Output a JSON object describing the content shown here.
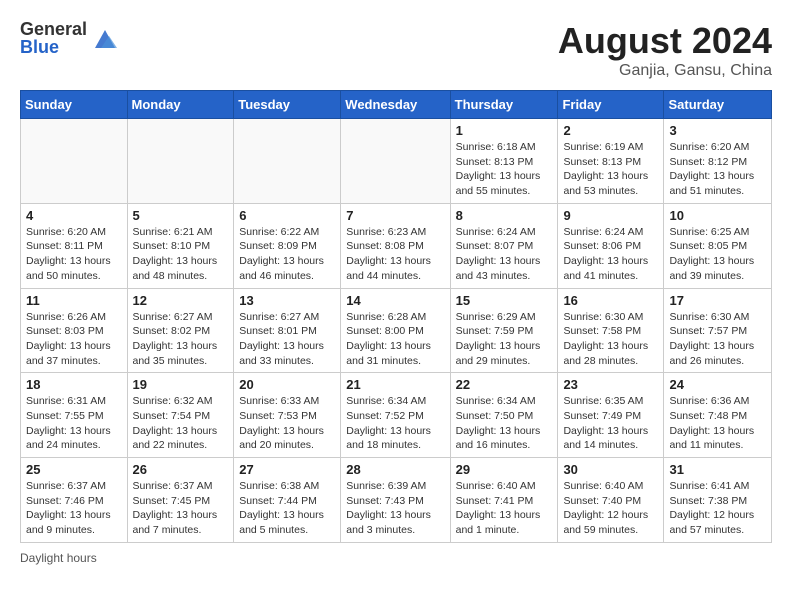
{
  "header": {
    "logo_general": "General",
    "logo_blue": "Blue",
    "month_title": "August 2024",
    "location": "Ganjia, Gansu, China"
  },
  "days_of_week": [
    "Sunday",
    "Monday",
    "Tuesday",
    "Wednesday",
    "Thursday",
    "Friday",
    "Saturday"
  ],
  "weeks": [
    [
      {
        "day": "",
        "info": ""
      },
      {
        "day": "",
        "info": ""
      },
      {
        "day": "",
        "info": ""
      },
      {
        "day": "",
        "info": ""
      },
      {
        "day": "1",
        "info": "Sunrise: 6:18 AM\nSunset: 8:13 PM\nDaylight: 13 hours\nand 55 minutes."
      },
      {
        "day": "2",
        "info": "Sunrise: 6:19 AM\nSunset: 8:13 PM\nDaylight: 13 hours\nand 53 minutes."
      },
      {
        "day": "3",
        "info": "Sunrise: 6:20 AM\nSunset: 8:12 PM\nDaylight: 13 hours\nand 51 minutes."
      }
    ],
    [
      {
        "day": "4",
        "info": "Sunrise: 6:20 AM\nSunset: 8:11 PM\nDaylight: 13 hours\nand 50 minutes."
      },
      {
        "day": "5",
        "info": "Sunrise: 6:21 AM\nSunset: 8:10 PM\nDaylight: 13 hours\nand 48 minutes."
      },
      {
        "day": "6",
        "info": "Sunrise: 6:22 AM\nSunset: 8:09 PM\nDaylight: 13 hours\nand 46 minutes."
      },
      {
        "day": "7",
        "info": "Sunrise: 6:23 AM\nSunset: 8:08 PM\nDaylight: 13 hours\nand 44 minutes."
      },
      {
        "day": "8",
        "info": "Sunrise: 6:24 AM\nSunset: 8:07 PM\nDaylight: 13 hours\nand 43 minutes."
      },
      {
        "day": "9",
        "info": "Sunrise: 6:24 AM\nSunset: 8:06 PM\nDaylight: 13 hours\nand 41 minutes."
      },
      {
        "day": "10",
        "info": "Sunrise: 6:25 AM\nSunset: 8:05 PM\nDaylight: 13 hours\nand 39 minutes."
      }
    ],
    [
      {
        "day": "11",
        "info": "Sunrise: 6:26 AM\nSunset: 8:03 PM\nDaylight: 13 hours\nand 37 minutes."
      },
      {
        "day": "12",
        "info": "Sunrise: 6:27 AM\nSunset: 8:02 PM\nDaylight: 13 hours\nand 35 minutes."
      },
      {
        "day": "13",
        "info": "Sunrise: 6:27 AM\nSunset: 8:01 PM\nDaylight: 13 hours\nand 33 minutes."
      },
      {
        "day": "14",
        "info": "Sunrise: 6:28 AM\nSunset: 8:00 PM\nDaylight: 13 hours\nand 31 minutes."
      },
      {
        "day": "15",
        "info": "Sunrise: 6:29 AM\nSunset: 7:59 PM\nDaylight: 13 hours\nand 29 minutes."
      },
      {
        "day": "16",
        "info": "Sunrise: 6:30 AM\nSunset: 7:58 PM\nDaylight: 13 hours\nand 28 minutes."
      },
      {
        "day": "17",
        "info": "Sunrise: 6:30 AM\nSunset: 7:57 PM\nDaylight: 13 hours\nand 26 minutes."
      }
    ],
    [
      {
        "day": "18",
        "info": "Sunrise: 6:31 AM\nSunset: 7:55 PM\nDaylight: 13 hours\nand 24 minutes."
      },
      {
        "day": "19",
        "info": "Sunrise: 6:32 AM\nSunset: 7:54 PM\nDaylight: 13 hours\nand 22 minutes."
      },
      {
        "day": "20",
        "info": "Sunrise: 6:33 AM\nSunset: 7:53 PM\nDaylight: 13 hours\nand 20 minutes."
      },
      {
        "day": "21",
        "info": "Sunrise: 6:34 AM\nSunset: 7:52 PM\nDaylight: 13 hours\nand 18 minutes."
      },
      {
        "day": "22",
        "info": "Sunrise: 6:34 AM\nSunset: 7:50 PM\nDaylight: 13 hours\nand 16 minutes."
      },
      {
        "day": "23",
        "info": "Sunrise: 6:35 AM\nSunset: 7:49 PM\nDaylight: 13 hours\nand 14 minutes."
      },
      {
        "day": "24",
        "info": "Sunrise: 6:36 AM\nSunset: 7:48 PM\nDaylight: 13 hours\nand 11 minutes."
      }
    ],
    [
      {
        "day": "25",
        "info": "Sunrise: 6:37 AM\nSunset: 7:46 PM\nDaylight: 13 hours\nand 9 minutes."
      },
      {
        "day": "26",
        "info": "Sunrise: 6:37 AM\nSunset: 7:45 PM\nDaylight: 13 hours\nand 7 minutes."
      },
      {
        "day": "27",
        "info": "Sunrise: 6:38 AM\nSunset: 7:44 PM\nDaylight: 13 hours\nand 5 minutes."
      },
      {
        "day": "28",
        "info": "Sunrise: 6:39 AM\nSunset: 7:43 PM\nDaylight: 13 hours\nand 3 minutes."
      },
      {
        "day": "29",
        "info": "Sunrise: 6:40 AM\nSunset: 7:41 PM\nDaylight: 13 hours\nand 1 minute."
      },
      {
        "day": "30",
        "info": "Sunrise: 6:40 AM\nSunset: 7:40 PM\nDaylight: 12 hours\nand 59 minutes."
      },
      {
        "day": "31",
        "info": "Sunrise: 6:41 AM\nSunset: 7:38 PM\nDaylight: 12 hours\nand 57 minutes."
      }
    ]
  ],
  "footer": {
    "daylight_hours": "Daylight hours"
  }
}
